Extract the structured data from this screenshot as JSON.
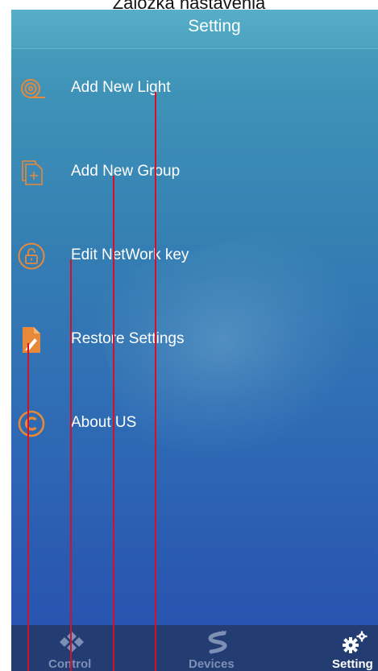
{
  "caption": "Záložka nastavenia",
  "header": {
    "title": "Setting"
  },
  "menu": {
    "items": [
      {
        "label": "Add New Light",
        "icon": "light-ring-icon"
      },
      {
        "label": "Add New Group",
        "icon": "add-group-icon"
      },
      {
        "label": "Edit NetWork key",
        "icon": "lock-icon"
      },
      {
        "label": "Restore Settings",
        "icon": "restore-document-icon"
      },
      {
        "label": "About US",
        "icon": "copyright-icon"
      }
    ]
  },
  "tabs": {
    "items": [
      {
        "label": "Control",
        "icon": "control-dpad-icon",
        "active": false
      },
      {
        "label": "Devices",
        "icon": "light-strip-icon",
        "active": false
      },
      {
        "label": "Setting",
        "icon": "gears-icon",
        "active": true
      }
    ]
  },
  "colors": {
    "accent_orange": "#e8893a",
    "tabbar_bg": "#233d73",
    "annotation_red": "#d3122a",
    "tab_active_text": "#ffffff",
    "tab_inactive_text": "#7d8fb5"
  }
}
